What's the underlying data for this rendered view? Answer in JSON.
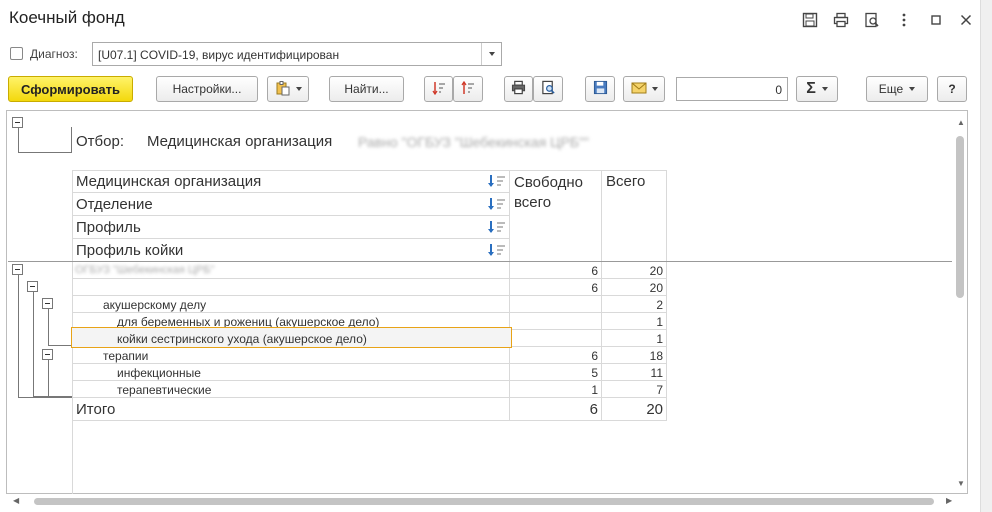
{
  "window": {
    "title": "Коечный фонд"
  },
  "filter": {
    "diagnosis_label": "Диагноз:",
    "diagnosis_value": "[U07.1] COVID-19, вирус идентифицирован"
  },
  "toolbar": {
    "generate_label": "Сформировать",
    "settings_label": "Настройки...",
    "find_label": "Найти...",
    "number_value": "0",
    "sum_symbol": "Σ",
    "more_label": "Еще",
    "help_label": "?"
  },
  "report": {
    "filter_caption": "Отбор:",
    "filter_field": "Медицинская организация",
    "filter_condition": "Равно \"ОГБУЗ \"Шебекинская ЦРБ\"\"",
    "group_headers": [
      "Медицинская организация",
      "Отделение",
      "Профиль",
      "Профиль койки"
    ],
    "col_free": "Свободно всего",
    "col_total": "Всего",
    "rows": [
      {
        "label": "ОГБУЗ \"Шебекинская ЦРБ\"",
        "free": "6",
        "total": "20"
      },
      {
        "label": "",
        "free": "6",
        "total": "20"
      },
      {
        "label": "акушерскому делу",
        "free": "",
        "total": "2"
      },
      {
        "label": "для беременных и рожениц (акушерское дело)",
        "free": "",
        "total": "1"
      },
      {
        "label": "койки сестринского ухода (акушерское дело)",
        "free": "",
        "total": "1"
      },
      {
        "label": "терапии",
        "free": "6",
        "total": "18"
      },
      {
        "label": "инфекционные",
        "free": "5",
        "total": "11"
      },
      {
        "label": "терапевтические",
        "free": "1",
        "total": "7"
      }
    ],
    "total_label": "Итого",
    "total_free": "6",
    "total_total": "20"
  },
  "icons": [
    "save-icon",
    "print-icon",
    "preview-icon",
    "more-vertical-icon",
    "maximize-icon",
    "close-icon",
    "sort-icon",
    "paste-icon",
    "email-icon",
    "dropdown-icon"
  ],
  "colors": {
    "primary_button": "#f5dc14",
    "selected_cell_border": "#e8a317",
    "grid_line": "#d9d9d9"
  }
}
